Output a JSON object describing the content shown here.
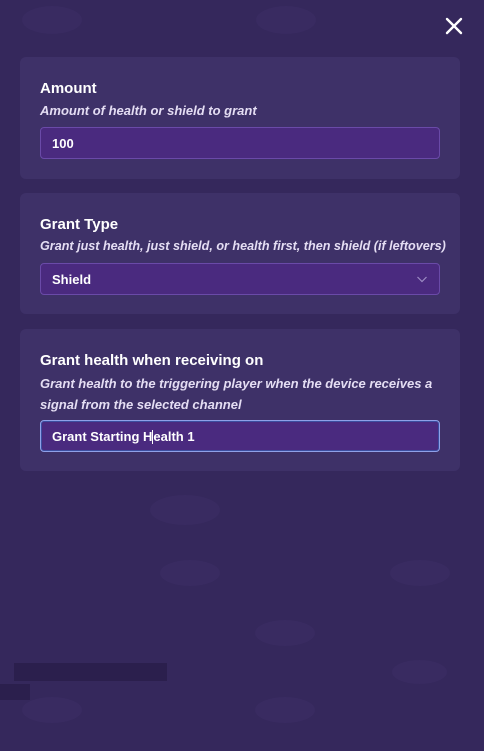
{
  "close": {
    "icon": "close-icon"
  },
  "amount": {
    "title": "Amount",
    "description": "Amount of health or shield to grant",
    "value": "100"
  },
  "grant_type": {
    "title": "Grant Type",
    "description": "Grant just health, just shield, or health first, then shield (if leftovers)",
    "selected": "Shield",
    "icon": "chevron-down-icon"
  },
  "receive_channel": {
    "title": "Grant health when receiving on",
    "description": "Grant health to the triggering player when the device receives a signal from the selected channel",
    "value_before_cursor": "Grant Starting H",
    "value_after_cursor": "ealth 1"
  },
  "colors": {
    "background": "#35285c",
    "card": "#3e3168",
    "field": "#4a2a7f",
    "field_border": "#6a4aa8",
    "focus_border": "#8fa0e8"
  }
}
